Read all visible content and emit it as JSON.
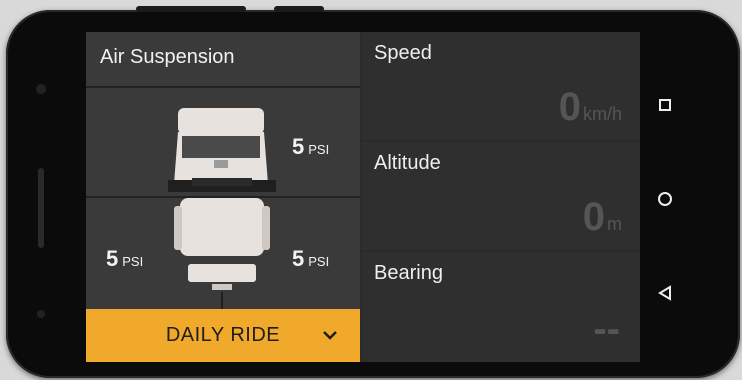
{
  "suspension": {
    "title": "Air Suspension",
    "front_right": {
      "value": "5",
      "unit": "PSI"
    },
    "rear_left": {
      "value": "5",
      "unit": "PSI"
    },
    "rear_right": {
      "value": "5",
      "unit": "PSI"
    },
    "mode": "DAILY RIDE"
  },
  "stats": [
    {
      "title": "Speed",
      "value": "0",
      "unit": "km/h"
    },
    {
      "title": "Altitude",
      "value": "0",
      "unit": "m"
    },
    {
      "title": "Bearing",
      "value": "--",
      "unit": ""
    }
  ],
  "colors": {
    "accent": "#f0a92a",
    "panel": "#3a3a3a",
    "screen": "#2b2b2b"
  },
  "icons": {
    "nav_recent": "square-icon",
    "nav_home": "circle-icon",
    "nav_back": "triangle-back-icon",
    "mode_dropdown": "chevron-down-icon"
  }
}
